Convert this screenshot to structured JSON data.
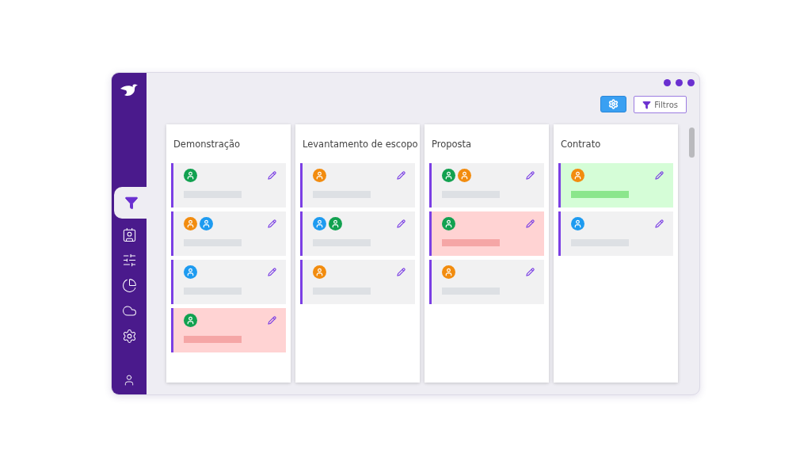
{
  "sidebar": {
    "items": [
      {
        "kind": "filter",
        "selected": true
      },
      {
        "kind": "contact",
        "selected": false
      },
      {
        "kind": "sliders",
        "selected": false
      },
      {
        "kind": "chart",
        "selected": false
      },
      {
        "kind": "cloud",
        "selected": false
      },
      {
        "kind": "settings",
        "selected": false
      }
    ]
  },
  "toolbar": {
    "filter_button": "Filtros"
  },
  "columns": [
    {
      "title": "Demonstração",
      "cards": [
        {
          "kind": "open",
          "avatars": [
            {
              "color": "#12a150"
            }
          ]
        },
        {
          "kind": "open",
          "avatars": [
            {
              "color": "#f28c0f"
            },
            {
              "color": "#1e9bf0"
            }
          ]
        },
        {
          "kind": "open",
          "avatars": [
            {
              "color": "#1e9bf0"
            }
          ]
        },
        {
          "kind": "lost",
          "avatars": [
            {
              "color": "#12a150"
            }
          ]
        }
      ]
    },
    {
      "title": "Levantamento de escopo",
      "cards": [
        {
          "kind": "open",
          "avatars": [
            {
              "color": "#f28c0f"
            }
          ]
        },
        {
          "kind": "open",
          "avatars": [
            {
              "color": "#1e9bf0"
            },
            {
              "color": "#12a150"
            }
          ]
        },
        {
          "kind": "open",
          "avatars": [
            {
              "color": "#f28c0f"
            }
          ]
        }
      ]
    },
    {
      "title": "Proposta",
      "cards": [
        {
          "kind": "open",
          "avatars": [
            {
              "color": "#12a150"
            },
            {
              "color": "#f28c0f"
            }
          ]
        },
        {
          "kind": "lost",
          "avatars": [
            {
              "color": "#12a150"
            }
          ]
        },
        {
          "kind": "open",
          "avatars": [
            {
              "color": "#f28c0f"
            }
          ]
        }
      ]
    },
    {
      "title": "Contrato",
      "cards": [
        {
          "kind": "won",
          "avatars": [
            {
              "color": "#f28c0f"
            }
          ]
        },
        {
          "kind": "open",
          "avatars": [
            {
              "color": "#1e9bf0"
            }
          ]
        }
      ]
    }
  ]
}
